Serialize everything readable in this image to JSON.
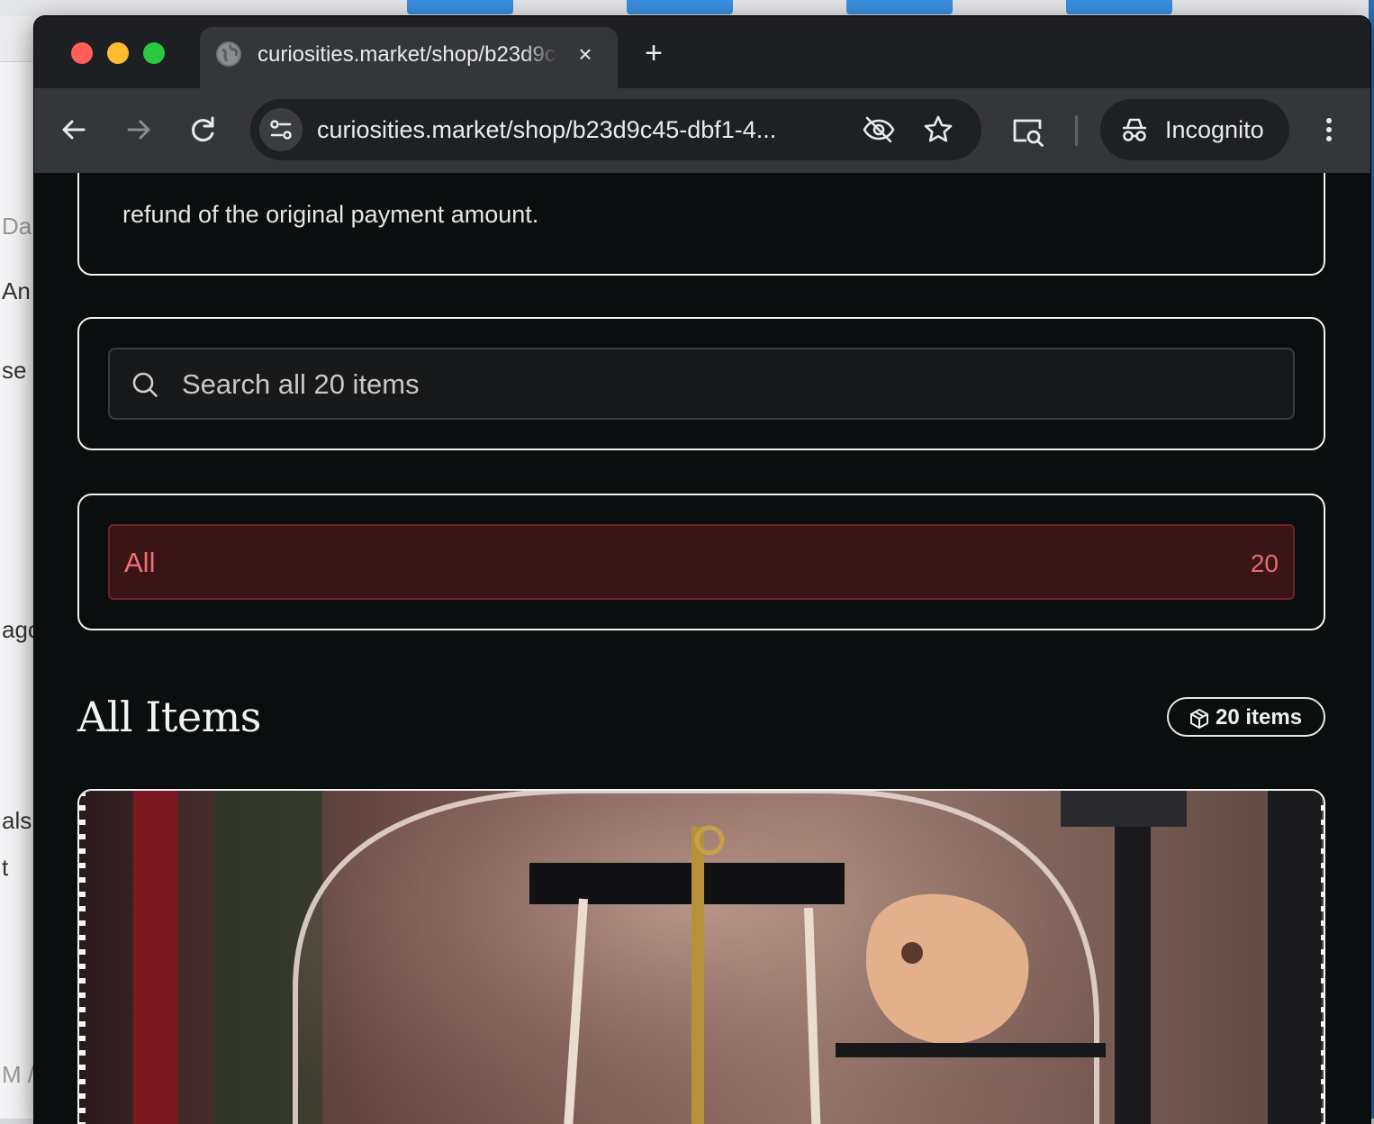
{
  "browser": {
    "tab_title": "curiosities.market/shop/b23d9c45",
    "tab_close_glyph": "×",
    "new_tab_glyph": "+",
    "url_host": "curiosities.market",
    "url_path": "/shop/b23d9c45-dbf1-4...",
    "incognito_label": "Incognito",
    "icons": [
      "back-icon",
      "forward-icon",
      "reload-icon",
      "site-info-icon",
      "eye-off-icon",
      "star-icon",
      "search-tab-icon",
      "incognito-icon",
      "more-menu-icon"
    ]
  },
  "background_app": {
    "fragments": [
      "Da",
      "An",
      "se",
      "ago",
      "als.",
      "t",
      "M /"
    ]
  },
  "page": {
    "policy_text": "refund of the original payment amount.",
    "search": {
      "placeholder": "Search all 20 items"
    },
    "filter": {
      "label": "All",
      "count": "20"
    },
    "section_title": "All Items",
    "item_count_badge": "20 items",
    "accent_color": "#f07070"
  }
}
